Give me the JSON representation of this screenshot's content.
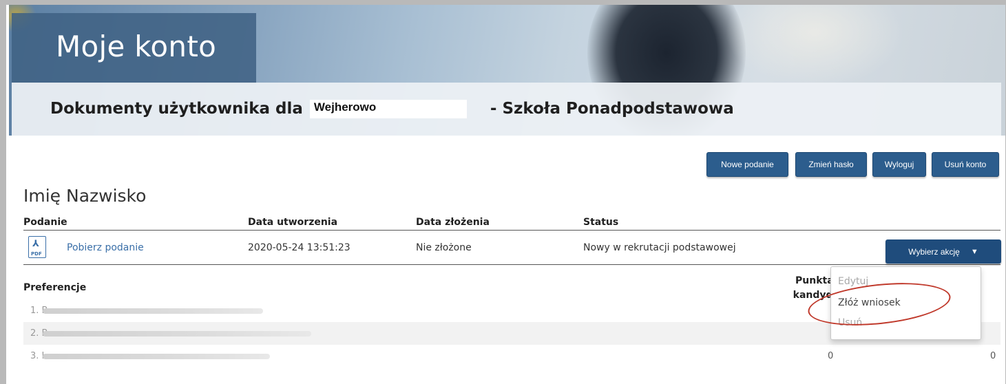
{
  "hero": {
    "title": "Moje konto",
    "doc_prefix": "Dokumenty użytkownika dla",
    "institution_visible": "Wejherowo",
    "doc_suffix": "- Szkoła Ponadpodstawowa"
  },
  "toolbar": {
    "new_label": "Nowe podanie",
    "change_password_label": "Zmień hasło",
    "logout_label": "Wyloguj",
    "delete_account_label": "Usuń konto"
  },
  "user": {
    "name": "Imię Nazwisko"
  },
  "table": {
    "headers": {
      "podanie": "Podanie",
      "created": "Data utworzenia",
      "submitted": "Data złożenia",
      "status": "Status"
    },
    "row": {
      "icon_label": "PDF",
      "download_label": "Pobierz podanie",
      "created": "2020-05-24 13:51:23",
      "submitted": "Nie złożone",
      "status": "Nowy w rekrutacji podstawowej",
      "action_label": "Wybierz akcję"
    }
  },
  "preferences": {
    "header": "Preferencje",
    "points_header_line1": "Punktac",
    "points_header_line2": "kandyda",
    "rows": [
      {
        "num": "1. B",
        "value_a": "",
        "value_b": ""
      },
      {
        "num": "2. B",
        "value_a": "",
        "value_b": ""
      },
      {
        "num": "3. I",
        "value_a": "0",
        "value_b": "0"
      }
    ]
  },
  "dropdown": {
    "items": [
      "Edytuj",
      "Złóż wniosek",
      "Usuń"
    ]
  },
  "colors": {
    "button_bg": "#2c5d8d",
    "action_bg": "#1f4c7c",
    "link": "#3a6fa8",
    "highlight_circle": "#c0392b"
  }
}
